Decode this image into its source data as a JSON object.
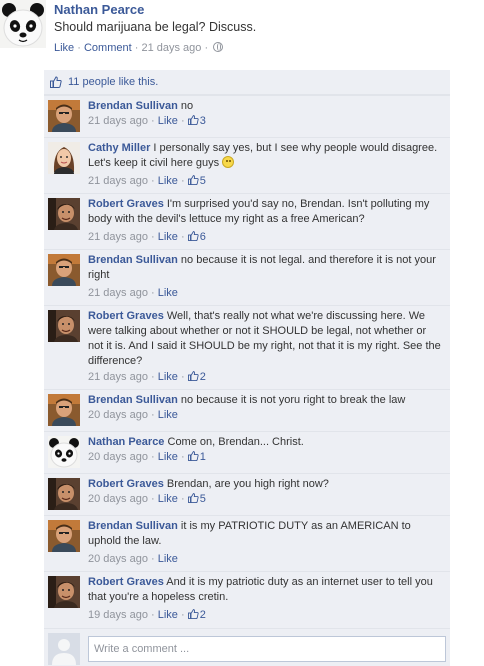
{
  "post": {
    "author": "Nathan Pearce",
    "text": "Should marijuana be legal? Discuss.",
    "like_label": "Like",
    "comment_label": "Comment",
    "time": "21 days ago",
    "avatar_icon": "panda-avatar"
  },
  "likes": {
    "text": "11 people like this.",
    "icon": "thumbs-up-icon"
  },
  "comments": [
    {
      "author": "Brendan Sullivan",
      "text": "no",
      "time": "21 days ago",
      "like_label": "Like",
      "likes": "3",
      "avatar": "brendan"
    },
    {
      "author": "Cathy Miller",
      "text": "I personally say yes, but I see why people would disagree. Let's keep it civil here guys",
      "time": "21 days ago",
      "like_label": "Like",
      "likes": "5",
      "avatar": "cathy",
      "emoticon": "smiley-icon"
    },
    {
      "author": "Robert Graves",
      "text": "I'm surprised you'd say no, Brendan. Isn't polluting my body with the devil's lettuce my right as a free American?",
      "time": "21 days ago",
      "like_label": "Like",
      "likes": "6",
      "avatar": "robert"
    },
    {
      "author": "Brendan Sullivan",
      "text": "no because it is not legal. and therefore it is not your right",
      "time": "21 days ago",
      "like_label": "Like",
      "likes": "",
      "avatar": "brendan"
    },
    {
      "author": "Robert Graves",
      "text": "Well, that's really not what we're discussing here. We were talking about whether or not it SHOULD be legal, not whether or not it is. And I said it SHOULD be my right, not that it is my right. See the difference?",
      "time": "21 days ago",
      "like_label": "Like",
      "likes": "2",
      "avatar": "robert"
    },
    {
      "author": "Brendan Sullivan",
      "text": "no because it is not yoru right to break the law",
      "time": "20 days ago",
      "like_label": "Like",
      "likes": "",
      "avatar": "brendan"
    },
    {
      "author": "Nathan Pearce",
      "text": "Come on, Brendan... Christ.",
      "time": "20 days ago",
      "like_label": "Like",
      "likes": "1",
      "avatar": "panda"
    },
    {
      "author": "Robert Graves",
      "text": "Brendan, are you high right now?",
      "time": "20 days ago",
      "like_label": "Like",
      "likes": "5",
      "avatar": "robert"
    },
    {
      "author": "Brendan Sullivan",
      "text": "it is my PATRIOTIC DUTY as an AMERICAN to uphold the law.",
      "time": "20 days ago",
      "like_label": "Like",
      "likes": "",
      "avatar": "brendan"
    },
    {
      "author": "Robert Graves",
      "text": "And it is my patriotic duty as an internet user to tell you that you're a hopeless cretin.",
      "time": "19 days ago",
      "like_label": "Like",
      "likes": "2",
      "avatar": "robert"
    }
  ],
  "write": {
    "placeholder": "Write a comment ..."
  },
  "colors": {
    "link": "#3b5998",
    "meta": "#90949c",
    "panel": "#edeff4"
  }
}
